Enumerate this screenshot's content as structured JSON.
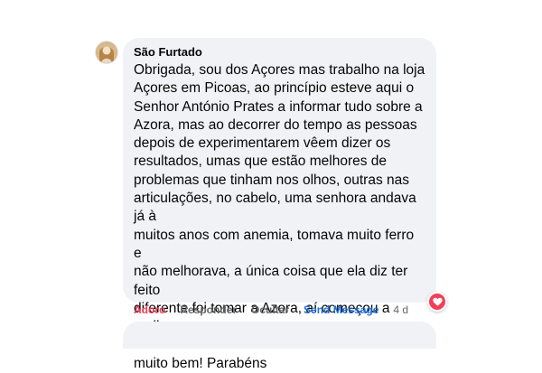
{
  "comment": {
    "author": "São Furtado",
    "text": "Obrigada, sou dos Açores mas trabalho na loja\nAçores em Picoas, ao princípio esteve aqui o\nSenhor António Prates a informar tudo sobre a\nAzora, mas ao decorrer do tempo as pessoas\ndepois de experimentarem vêem dizer os\nresultados, umas que estão melhores de\nproblemas que tinham nos olhos, outras nas\narticulações, no cabelo, uma senhora andava já à\nmuitos anos com anemia, tomava muito ferro e\nnão melhorava, a única coisa que ela diz ter feito\ndiferente foi tomar a Azora, aí começou a melhorar\nEu também tomo e também estou a sentir-me\nmuito bem! Parabéns",
    "reaction_icon": "heart-icon",
    "reaction_color": "#f33e58"
  },
  "actions": {
    "love_label": "Adoro",
    "reply_label": "Responder",
    "hide_label": "Ocultar",
    "send_message_label": "Send Message",
    "timestamp": "4 d"
  },
  "colors": {
    "bubble": "#f0f2f5",
    "action_text": "#65676b",
    "love_active": "#f33e58",
    "send_message": "#216fdb"
  }
}
